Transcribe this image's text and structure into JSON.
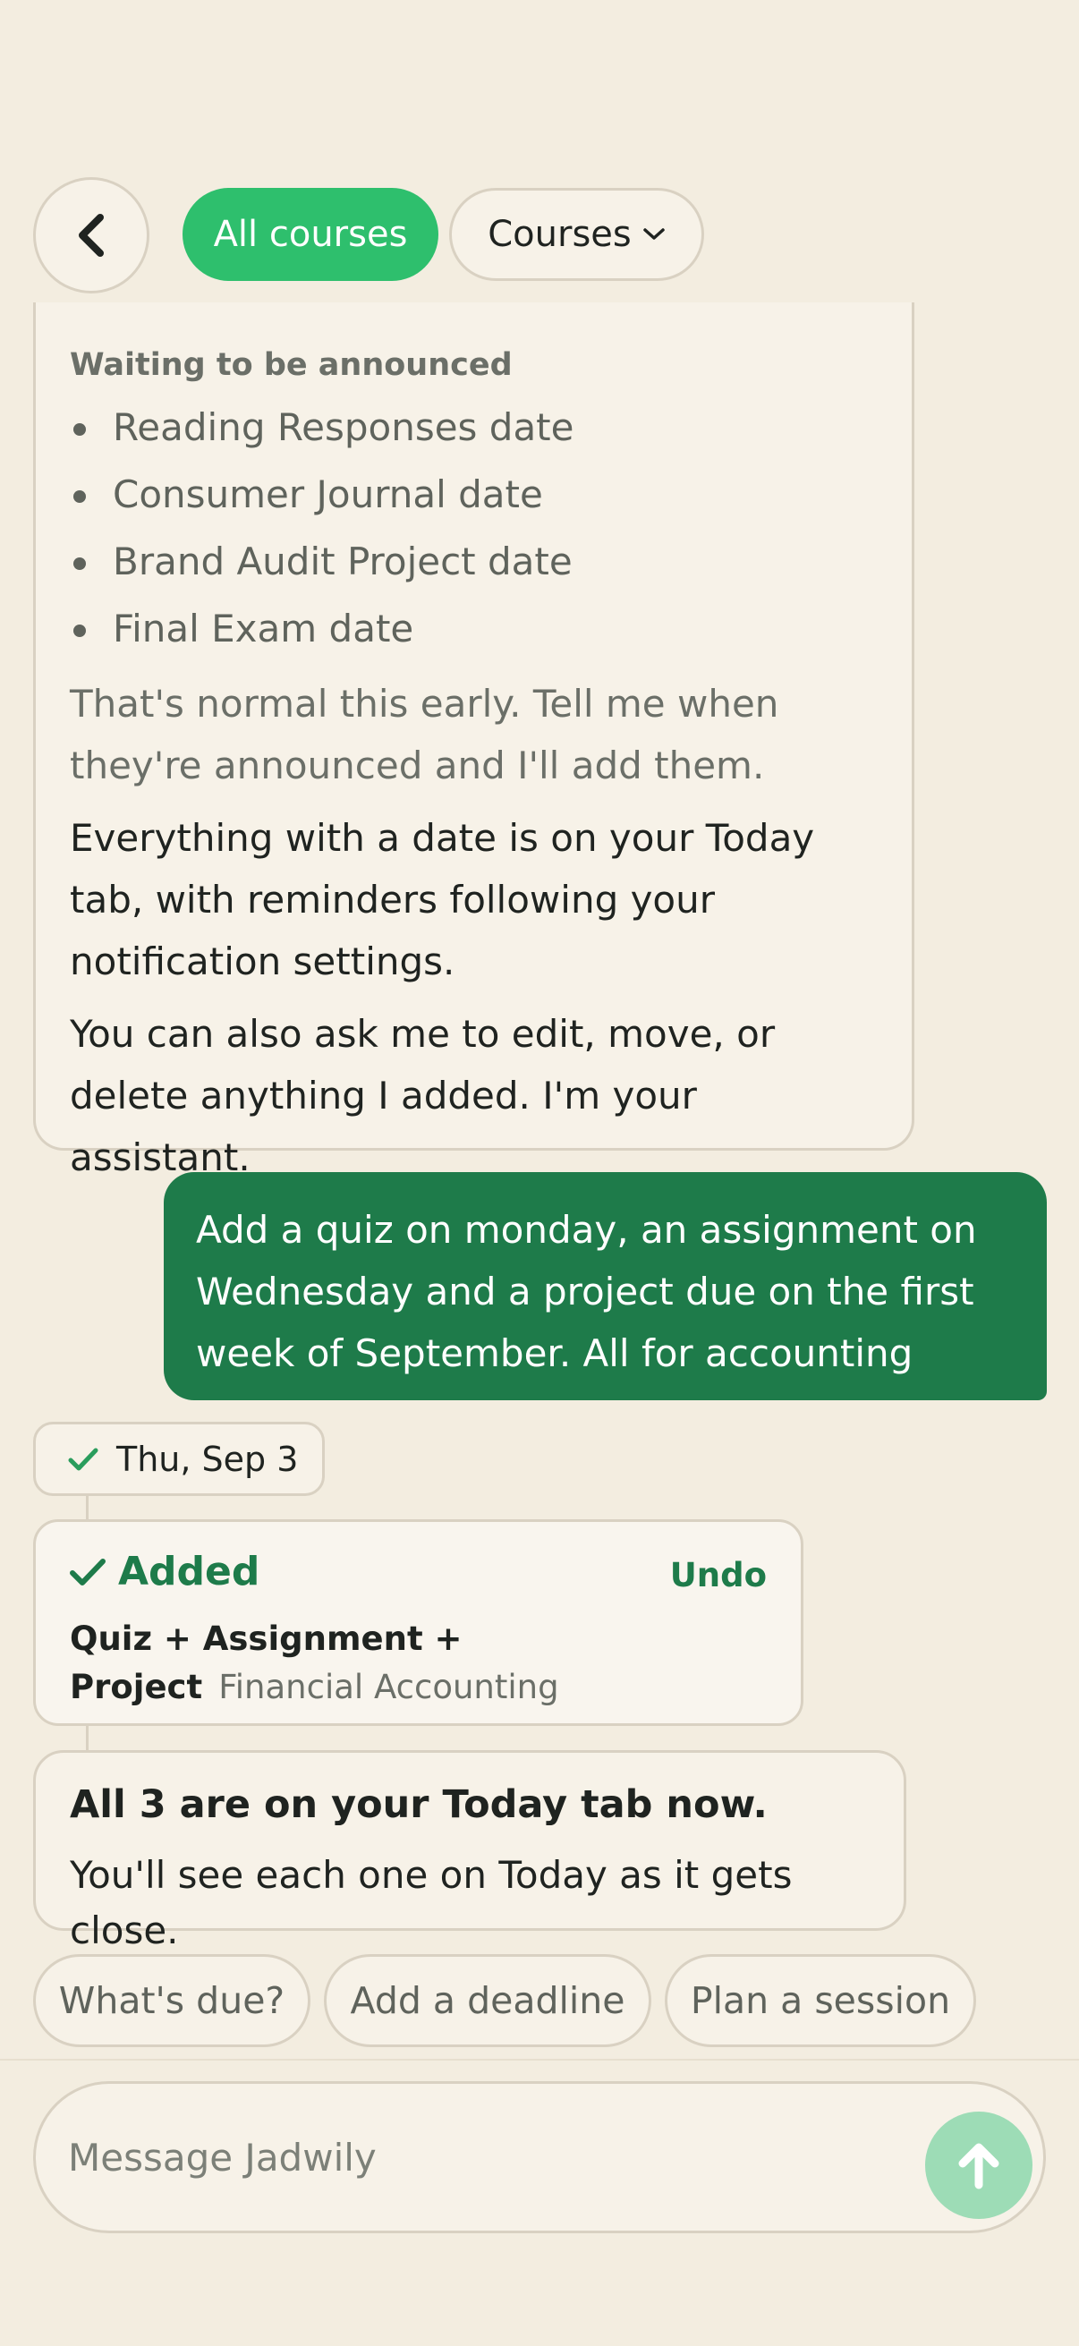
{
  "header": {
    "back_icon": "chevron-left-icon",
    "filter_all": "All courses",
    "filter_courses": "Courses"
  },
  "assistant_card": {
    "waiting_title": "Waiting to be announced",
    "pending_items": [
      "Reading Responses date",
      "Consumer Journal date",
      "Brand Audit Project date",
      "Final Exam date"
    ],
    "normal_note": "That's normal this early. Tell me when they're announced and I'll add them.",
    "today_note": "Everything with a date is on your Today tab, with reminders following your notification settings.",
    "edit_note": "You can also ask me to edit, move, or delete anything I added. I'm your assistant."
  },
  "user_message": "Add a quiz on monday, an assignment on Wednesday and a project due on the first week of September. All for accounting",
  "date_pill": "Thu, Sep 3",
  "added_card": {
    "status": "Added",
    "undo": "Undo",
    "items": "Quiz + Assignment + Project",
    "course": "Financial Accounting"
  },
  "summary": {
    "title": "All 3 are on your Today tab now.",
    "text": "You'll see each one on Today as it gets close."
  },
  "suggestions": [
    "What's due?",
    "Add a deadline",
    "Plan a session"
  ],
  "composer": {
    "placeholder": "Message Jadwily",
    "send_icon": "arrow-up-icon"
  },
  "colors": {
    "accent": "#2ebf6d",
    "user_bubble": "#1e7b4a",
    "background": "#f3ede0",
    "send_button": "#9ddcb6"
  }
}
